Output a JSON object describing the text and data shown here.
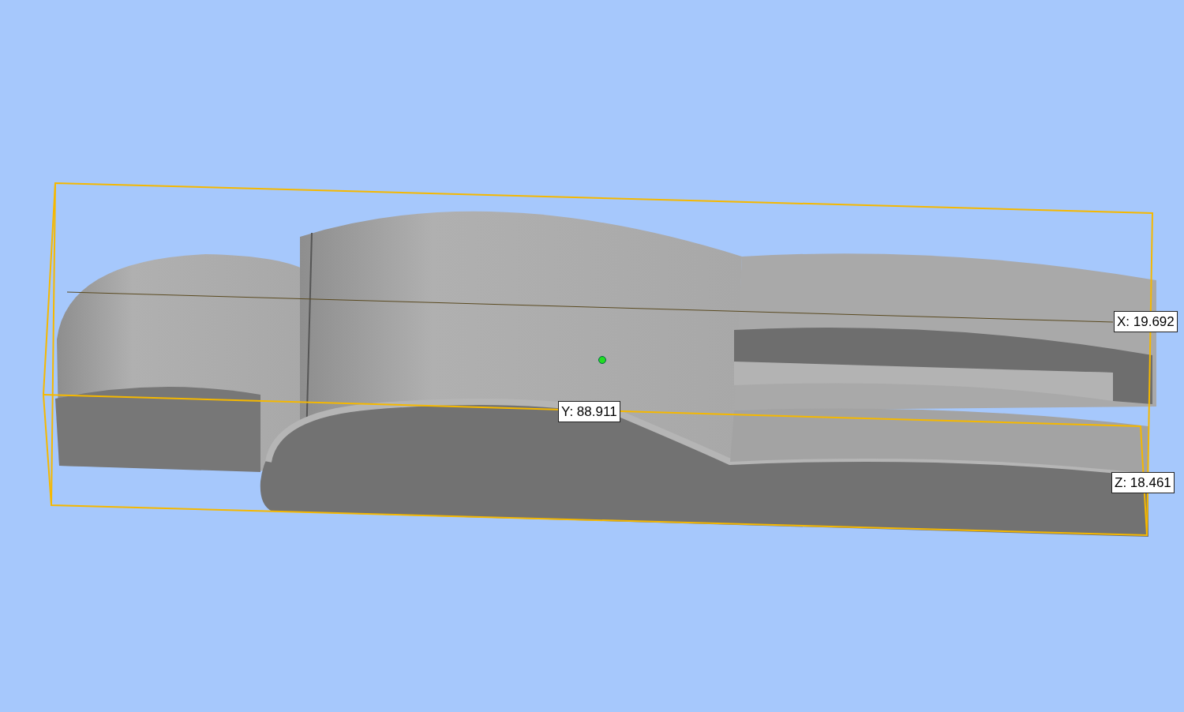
{
  "viewport": {
    "dimension_labels": [
      "X: 19.692",
      "Y: 88.911",
      "Z: 18.461"
    ]
  }
}
